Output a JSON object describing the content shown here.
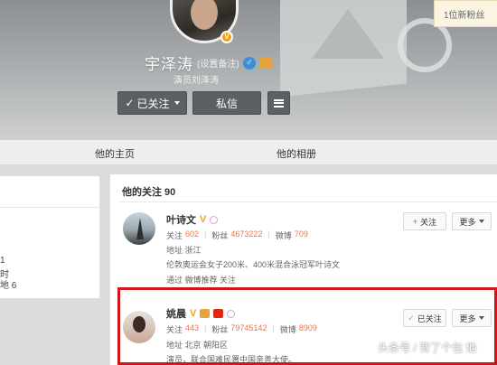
{
  "profile": {
    "name": "宇泽涛",
    "name_tag": "(设置备注)",
    "bio": "演员刘泽涛",
    "follow_button": "已关注",
    "message_button": "私信",
    "new_fans_notice": "1位新粉丝"
  },
  "tabs": [
    {
      "label": "他的主页"
    },
    {
      "label": "他的相册"
    }
  ],
  "sidebar": {
    "lines": [
      "1",
      "时",
      "地 6"
    ]
  },
  "following": {
    "title": "他的关注 90",
    "users": [
      {
        "name": "叶诗文",
        "follow_label": "关注",
        "follow_count": "602",
        "fans_label": "粉丝",
        "fans_count": "4673222",
        "weibo_label": "微博",
        "weibo_count": "709",
        "address": "地址 浙江",
        "desc": "伦敦奥运会女子200米、400米混合泳冠军叶诗文",
        "via": "通过 微博推荐 关注",
        "action_button": "关注",
        "more_button": "更多"
      },
      {
        "name": "姚晨",
        "follow_label": "关注",
        "follow_count": "443",
        "fans_label": "粉丝",
        "fans_count": "79745142",
        "weibo_label": "微博",
        "weibo_count": "8909",
        "address": "地址 北京 朝阳区",
        "desc": "演员，联合国难民署中国亲善大使。",
        "action_button": "已关注",
        "more_button": "更多"
      }
    ]
  },
  "watermark": "头条号 / 背了个包 他",
  "colors": {
    "accent_orange": "#eb7350",
    "highlight_red": "#d0161a",
    "dark_button": "#5b6064"
  }
}
